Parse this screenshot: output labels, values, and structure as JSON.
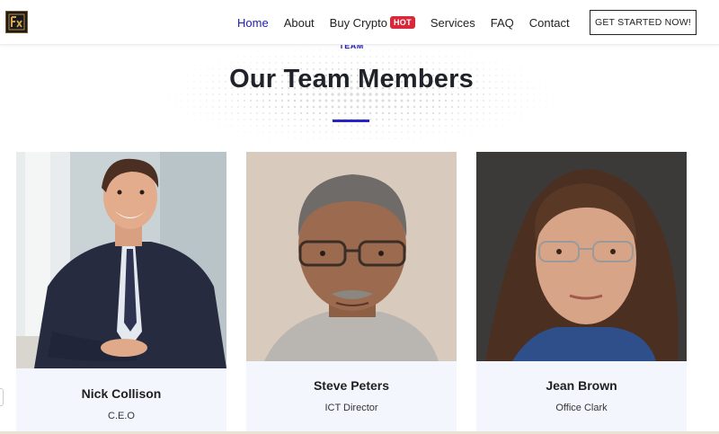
{
  "header": {
    "logo_icon": "fx-logo-icon",
    "nav": [
      {
        "label": "Home",
        "active": true
      },
      {
        "label": "About"
      },
      {
        "label": "Buy Crypto",
        "badge": "HOT"
      },
      {
        "label": "Services"
      },
      {
        "label": "FAQ"
      },
      {
        "label": "Contact"
      }
    ],
    "cta_label": "GET STARTED NOW!"
  },
  "section": {
    "eyebrow": "TEAM",
    "title": "Our Team Members"
  },
  "team": [
    {
      "name": "Nick Collison",
      "role": "C.E.O"
    },
    {
      "name": "Steve Peters",
      "role": "ICT Director"
    },
    {
      "name": "Jean Brown",
      "role": "Office Clark"
    }
  ],
  "colors": {
    "accent": "#1f1bb5",
    "badge": "#d8283a",
    "card_bg": "#f3f7fd"
  }
}
